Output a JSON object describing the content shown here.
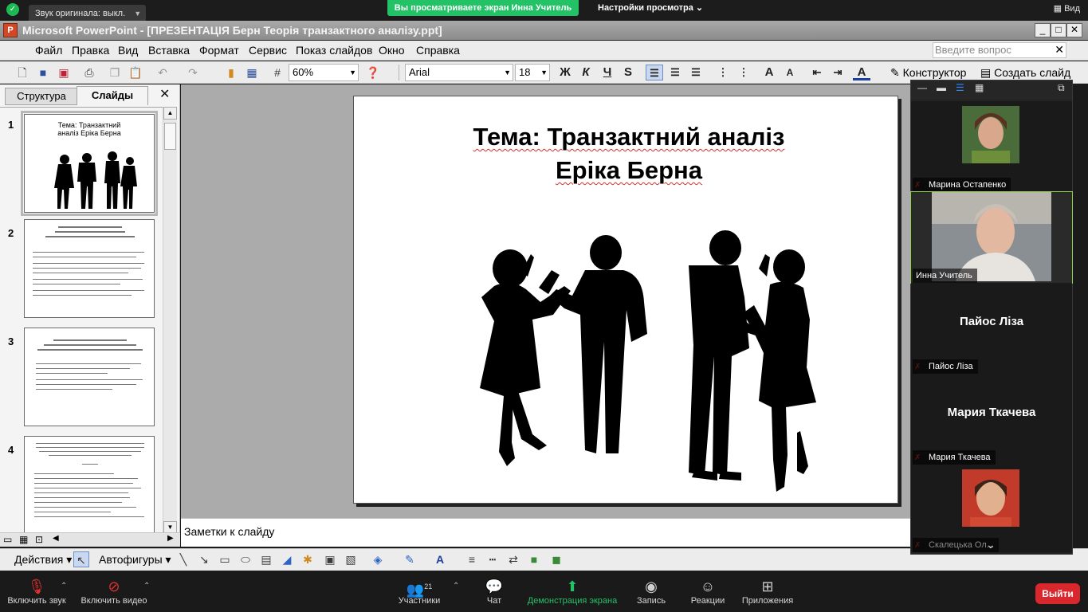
{
  "zoom": {
    "original_sound": "Звук оригинала: выкл.",
    "viewing_banner": "Вы просматриваете экран Инна Учитель",
    "view_settings": "Настройки просмотра",
    "view_button": "Вид",
    "controls": {
      "mic": "Включить звук",
      "video": "Включить видео",
      "participants": "Участники",
      "participants_count": "21",
      "chat": "Чат",
      "share": "Демонстрация экрана",
      "record": "Запись",
      "reactions": "Реакции",
      "apps": "Приложения",
      "leave": "Выйти"
    },
    "participants": [
      {
        "name": "Марина Остапенко",
        "muted": true
      },
      {
        "name": "Инна Учитель",
        "muted": false
      },
      {
        "name": "Пайос Ліза",
        "muted": true
      },
      {
        "name": "Мария Ткачева",
        "muted": true
      },
      {
        "name": "Скалецька Ол...",
        "muted": true
      }
    ],
    "accent_green": "#23c267",
    "leave_red": "#d9272e"
  },
  "ppt": {
    "window_title": "Microsoft PowerPoint - [ПРЕЗЕНТАЦІЯ Берн Теорія транзактного аналізу.ppt]",
    "menu": [
      "Файл",
      "Правка",
      "Вид",
      "Вставка",
      "Формат",
      "Сервис",
      "Показ слайдов",
      "Окно",
      "Справка"
    ],
    "ask_placeholder": "Введите вопрос",
    "zoom_level": "60%",
    "font_name": "Arial",
    "font_size": "18",
    "format_buttons": {
      "bold": "Ж",
      "italic": "К",
      "underline": "Ч",
      "shadow": "S"
    },
    "designer": "Конструктор",
    "new_slide": "Создать слайд",
    "tabs": {
      "structure": "Структура",
      "slides": "Слайды"
    },
    "thumbnails": [
      {
        "num": "1",
        "title": "Тема: Транзактний аналіз Еріка Берна"
      },
      {
        "num": "2",
        "title": ""
      },
      {
        "num": "3",
        "title": ""
      },
      {
        "num": "4",
        "title": ""
      }
    ],
    "slide_title_1": "Тема: Транзактний аналіз",
    "slide_title_2": "Еріка Берна",
    "notes_placeholder": "Заметки к слайду",
    "draw_actions": "Действия",
    "autoshapes": "Автофигуры"
  }
}
